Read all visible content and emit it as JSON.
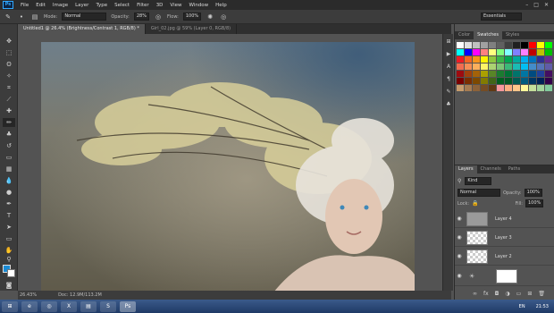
{
  "app": {
    "logo": "Ps"
  },
  "menu": [
    "File",
    "Edit",
    "Image",
    "Layer",
    "Type",
    "Select",
    "Filter",
    "3D",
    "View",
    "Window",
    "Help"
  ],
  "options": {
    "mode_label": "Mode:",
    "mode_value": "Normal",
    "opacity_label": "Opacity:",
    "opacity_value": "28%",
    "flow_label": "Flow:",
    "flow_value": "100%",
    "workspace": "Essentials"
  },
  "tabs": [
    {
      "label": "Untitled1 @ 26.4% (Brightness/Contrast 1, RGB/8) *",
      "active": true
    },
    {
      "label": "Girl_02.jpg @ 59% (Layer 0, RGB/8)",
      "active": false
    }
  ],
  "status": {
    "zoom": "26.43%",
    "doc": "Doc: 12.9M/113.2M"
  },
  "color_panel": {
    "tabs": [
      "Color",
      "Swatches",
      "Styles"
    ],
    "active": "Swatches"
  },
  "layers_panel": {
    "tabs": [
      "Layers",
      "Channels",
      "Paths"
    ],
    "kind": "Kind",
    "blend": "Normal",
    "opacity_label": "Opacity:",
    "opacity": "100%",
    "lock_label": "Lock:",
    "fill_label": "Fill:",
    "fill": "100%",
    "layers": [
      "Layer 4",
      "Layer 3",
      "Layer 2"
    ]
  },
  "taskbar": {
    "lang": "EN",
    "time": "21:53"
  },
  "colors": {
    "fg": "#1a8ad4",
    "bg": "#ffffff"
  }
}
